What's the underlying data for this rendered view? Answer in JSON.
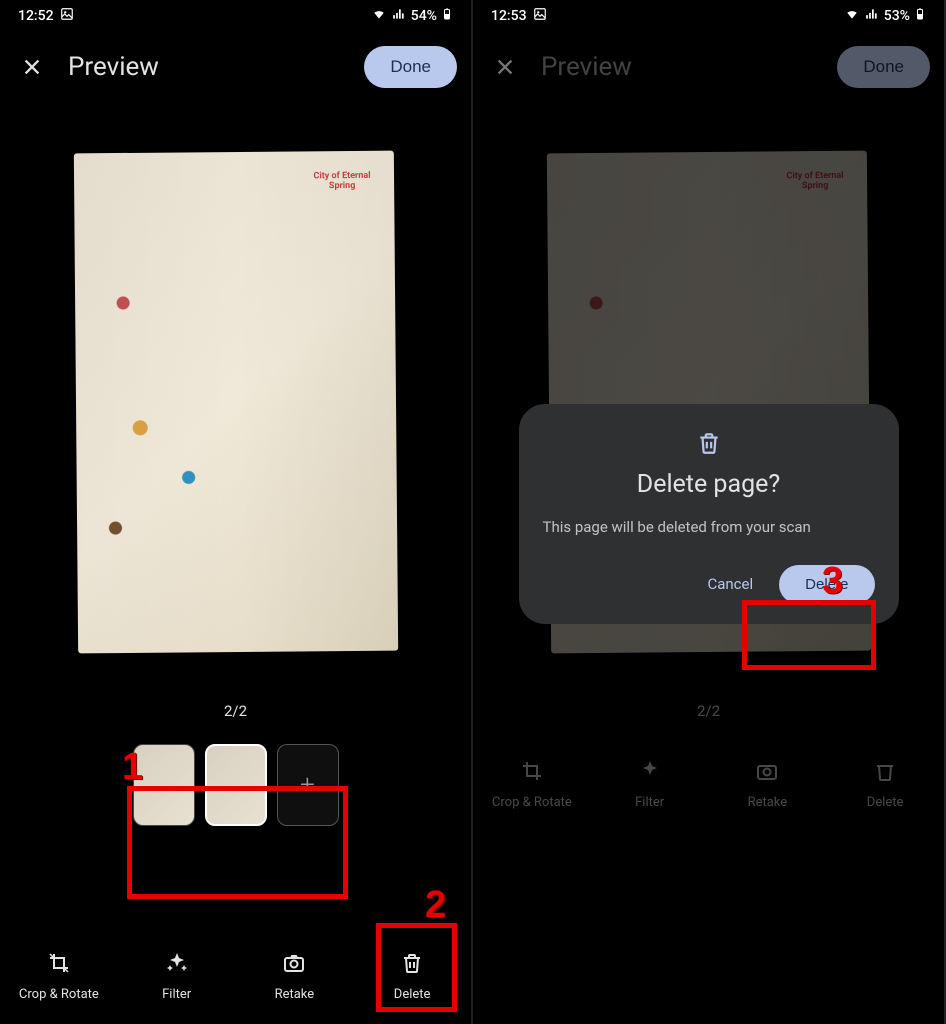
{
  "left": {
    "status": {
      "time": "12:52",
      "battery": "54%"
    },
    "title": "Preview",
    "done": "Done",
    "page_count": "2/2",
    "actions": {
      "crop": "Crop & Rotate",
      "filter": "Filter",
      "retake": "Retake",
      "delete": "Delete"
    },
    "annotations": {
      "one": "1",
      "two": "2"
    }
  },
  "right": {
    "status": {
      "time": "12:53",
      "battery": "53%"
    },
    "title": "Preview",
    "done": "Done",
    "page_count": "2/2",
    "actions": {
      "crop": "Crop & Rotate",
      "filter": "Filter",
      "retake": "Retake",
      "delete": "Delete"
    },
    "dialog": {
      "title": "Delete page?",
      "body": "This page will be deleted from your scan",
      "cancel": "Cancel",
      "confirm": "Delete"
    },
    "annotations": {
      "three": "3"
    }
  }
}
